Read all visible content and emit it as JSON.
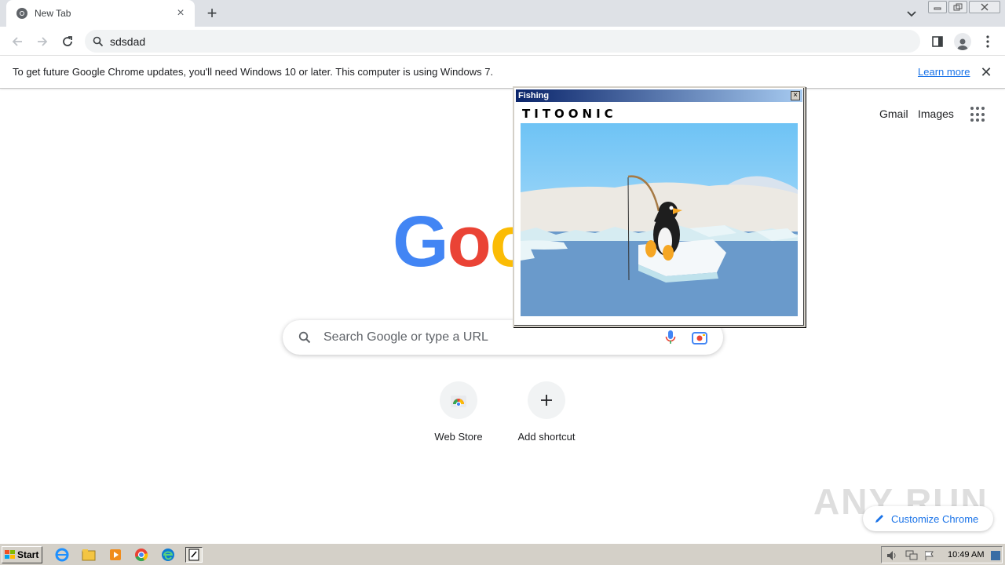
{
  "browser": {
    "tab": {
      "title": "New Tab"
    },
    "omnibox": {
      "value": "sdsdad"
    }
  },
  "infobar": {
    "message": "To get future Google Chrome updates, you'll need Windows 10 or later. This computer is using Windows 7.",
    "link": "Learn more"
  },
  "ntp": {
    "top_links": {
      "gmail": "Gmail",
      "images": "Images"
    },
    "logo_visible": "Goo",
    "search": {
      "placeholder": "Search Google or type a URL"
    },
    "shortcuts": [
      {
        "label": "Web Store"
      },
      {
        "label": "Add shortcut"
      }
    ],
    "customize_label": "Customize Chrome",
    "watermark": "ANY RUN"
  },
  "fishing_window": {
    "title": "Fishing",
    "brand": "TITOONIC",
    "close_label": "×"
  },
  "taskbar": {
    "start_label": "Start",
    "clock": "10:49 AM"
  },
  "colors": {
    "google_blue": "#4285F4",
    "google_red": "#EA4335",
    "google_yellow": "#FBBC05",
    "link_blue": "#1a73e8",
    "title_gradient_start": "#0a246a",
    "title_gradient_end": "#a6caf0"
  }
}
